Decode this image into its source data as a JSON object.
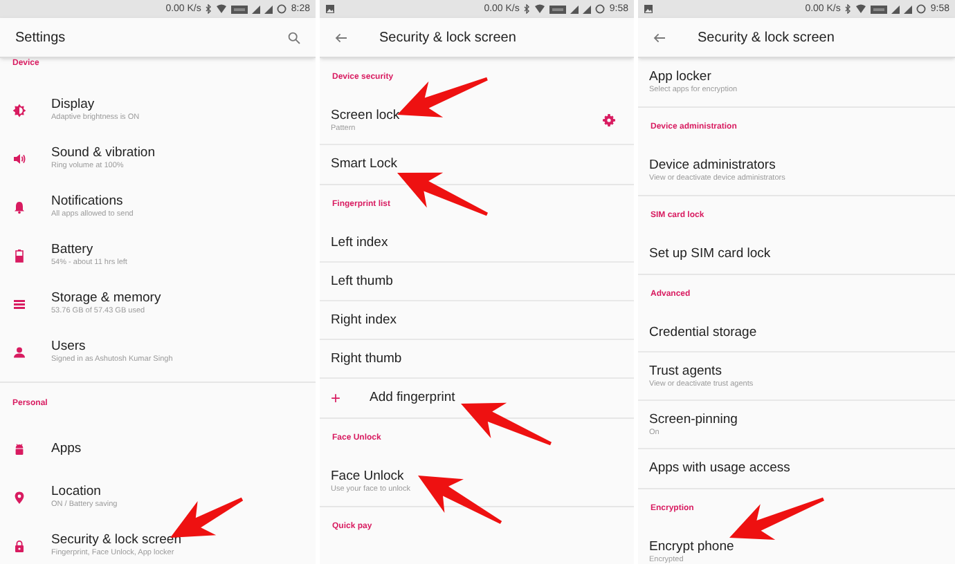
{
  "screens": [
    {
      "kind": "main",
      "status_bar": {
        "notification_icon": false,
        "speed": "0.00 K/s",
        "time": "8:28"
      },
      "app_bar": {
        "title": "Settings",
        "back": false,
        "search": true
      },
      "sections": [
        {
          "header": "Device",
          "items": [
            {
              "kind": "icon",
              "title": "Display",
              "subtitle": "Adaptive brightness is ON"
            },
            {
              "kind": "icon",
              "title": "Sound & vibration",
              "subtitle": "Ring volume at 100%"
            },
            {
              "kind": "icon",
              "title": "Notifications",
              "subtitle": "All apps allowed to send"
            },
            {
              "kind": "icon",
              "title": "Battery",
              "subtitle": "54% - about 11 hrs left"
            },
            {
              "kind": "icon",
              "title": "Storage & memory",
              "subtitle": "53.76 GB of 57.43 GB used"
            },
            {
              "kind": "icon",
              "title": "Users",
              "subtitle": "Signed in as Ashutosh Kumar Singh"
            }
          ]
        },
        {
          "header": "Personal",
          "items": [
            {
              "kind": "icon",
              "title": "Apps"
            },
            {
              "kind": "icon",
              "title": "Location",
              "subtitle": "ON / Battery saving"
            },
            {
              "kind": "icon",
              "title": "Security & lock screen",
              "subtitle": "Fingerprint, Face Unlock, App locker"
            }
          ]
        }
      ]
    },
    {
      "kind": "detail",
      "status_bar": {
        "notification_icon": true,
        "speed": "0.00 K/s",
        "time": "9:58"
      },
      "app_bar": {
        "title": "Security & lock screen",
        "back": true,
        "search": false
      },
      "sections": [
        {
          "header": "Device security",
          "items": [
            {
              "kind": "gear",
              "title": "Screen lock",
              "subtitle": "Pattern"
            },
            {
              "kind": "plain",
              "title": "Smart Lock"
            }
          ]
        },
        {
          "header": "Fingerprint list",
          "items": [
            {
              "kind": "plain",
              "title": "Left index"
            },
            {
              "kind": "plain",
              "title": "Left thumb"
            },
            {
              "kind": "plain",
              "title": "Right index"
            },
            {
              "kind": "plain",
              "title": "Right thumb"
            },
            {
              "kind": "add",
              "icon_text": "+",
              "title": "Add fingerprint"
            }
          ]
        },
        {
          "header": "Face Unlock",
          "items": [
            {
              "kind": "plain",
              "title": "Face Unlock",
              "subtitle": "Use your face to unlock"
            }
          ]
        },
        {
          "header": "Quick pay"
        }
      ]
    },
    {
      "kind": "detail",
      "status_bar": {
        "notification_icon": true,
        "speed": "0.00 K/s",
        "time": "9:58"
      },
      "app_bar": {
        "title": "Security & lock screen",
        "back": true,
        "search": false
      },
      "sections": [
        {
          "items": [
            {
              "kind": "plain",
              "title": "App locker",
              "subtitle": "Select apps for encryption"
            }
          ]
        },
        {
          "header": "Device administration",
          "items": [
            {
              "kind": "plain",
              "title": "Device administrators",
              "subtitle": "View or deactivate device administrators"
            }
          ]
        },
        {
          "header": "SIM card lock",
          "items": [
            {
              "kind": "plain",
              "title": "Set up SIM card lock"
            }
          ]
        },
        {
          "header": "Advanced",
          "items": [
            {
              "kind": "plain",
              "title": "Credential storage"
            },
            {
              "kind": "plain",
              "title": "Trust agents",
              "subtitle": "View or deactivate trust agents"
            },
            {
              "kind": "plain",
              "title": "Screen-pinning",
              "subtitle": "On"
            },
            {
              "kind": "plain",
              "title": "Apps with usage access"
            }
          ]
        },
        {
          "header": "Encryption",
          "items": [
            {
              "kind": "plain",
              "title": "Encrypt phone",
              "subtitle": "Encrypted"
            }
          ]
        }
      ]
    }
  ]
}
